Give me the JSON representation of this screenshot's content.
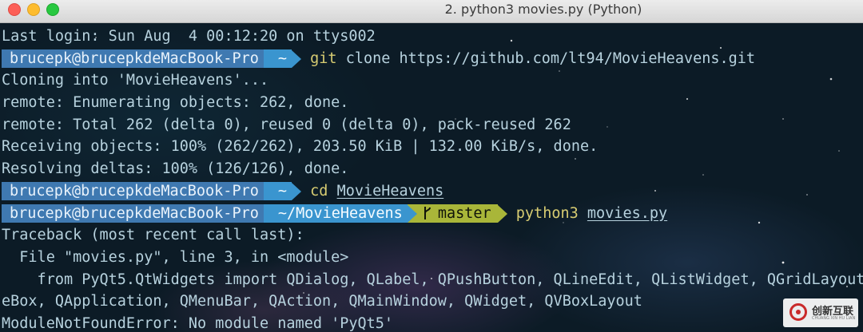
{
  "window": {
    "title": "2. python3 movies.py (Python)"
  },
  "prompt": {
    "user": "brucepk@brucepkdeMacBook-Pro",
    "home": "~",
    "repo_dir": "~/MovieHeavens",
    "branch": "master",
    "branch_icon": "git-branch-icon"
  },
  "lines": {
    "last_login": "Last login: Sun Aug  4 00:12:20 on ttys002",
    "cmd1": {
      "cmd": "git",
      "args": "clone https://github.com/lt94/MovieHeavens.git"
    },
    "out1": "Cloning into 'MovieHeavens'...",
    "out2": "remote: Enumerating objects: 262, done.",
    "out3": "remote: Total 262 (delta 0), reused 0 (delta 0), pack-reused 262",
    "out4": "Receiving objects: 100% (262/262), 203.50 KiB | 132.00 KiB/s, done.",
    "out5": "Resolving deltas: 100% (126/126), done.",
    "cmd2": {
      "cmd": "cd",
      "args": "MovieHeavens"
    },
    "cmd3": {
      "cmd": "python3",
      "args": "movies.py"
    },
    "tb1": "Traceback (most recent call last):",
    "tb2": "  File \"movies.py\", line 3, in <module>",
    "tb3": "    from PyQt5.QtWidgets import QDialog, QLabel, QPushButton, QLineEdit, QListWidget, QGridLayout, QComb",
    "tb4": "eBox, QApplication, QMenuBar, QAction, QMainWindow, QWidget, QVBoxLayout",
    "err": "ModuleNotFoundError: No module named 'PyQt5'"
  },
  "watermark": {
    "text": "创新互联",
    "sub": "CHUANG XIN HU LIAN"
  },
  "colors": {
    "user_bg": "#3f79b1",
    "dir_bg": "#3a95cf",
    "git_bg": "#a9b639",
    "cmd": "#d7cc72",
    "text": "#b7d2de"
  }
}
